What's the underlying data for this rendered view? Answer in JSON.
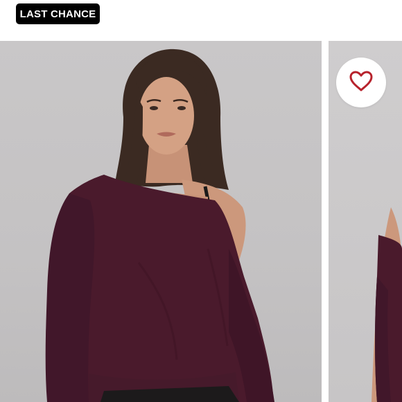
{
  "badge": {
    "label": "LAST CHANCE"
  },
  "favorite": {
    "icon": "heart-outline-icon",
    "color": "#b7222c"
  },
  "gallery": {
    "main_image": "model-wearing-off-shoulder-sweatshirt",
    "next_image": "model-wearing-off-shoulder-sweatshirt-partial"
  },
  "colors": {
    "garment": "#4a1a2c",
    "background": "#c6c4c5",
    "badge_bg": "#000000"
  }
}
